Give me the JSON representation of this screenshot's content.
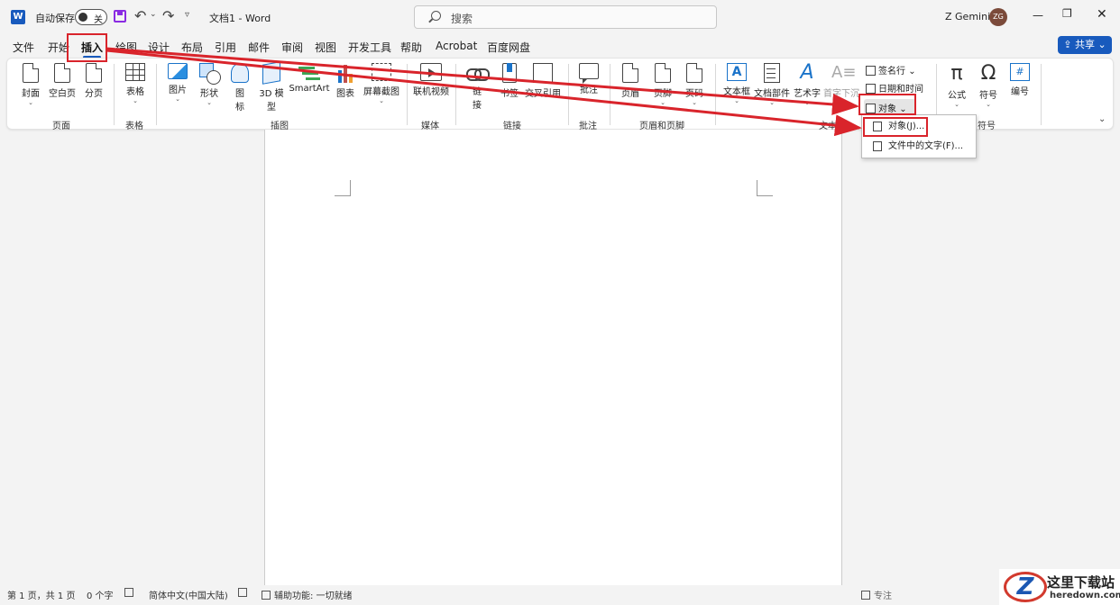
{
  "titlebar": {
    "app_letter": "W",
    "autosave_label": "自动保存",
    "autosave_state": "关",
    "doc_title": "文档1 - Word",
    "search_placeholder": "搜索",
    "user_name": "Z Gemini",
    "user_initials": "ZG"
  },
  "tabs": [
    "文件",
    "开始",
    "插入",
    "绘图",
    "设计",
    "布局",
    "引用",
    "邮件",
    "审阅",
    "视图",
    "开发工具",
    "帮助",
    "Acrobat",
    "百度网盘"
  ],
  "active_tab": "插入",
  "share_label": "共享",
  "ribbon": {
    "pages": {
      "label": "页面",
      "cover": "封面",
      "blank": "空白页",
      "break": "分页"
    },
    "tables": {
      "label": "表格",
      "table": "表格"
    },
    "illustrations": {
      "label": "插图",
      "pictures": "图片",
      "shapes": "形状",
      "icons_1": "图",
      "icons_2": "标",
      "model3d_1": "3D 模",
      "model3d_2": "型",
      "smartart": "SmartArt",
      "chart": "图表",
      "screenshot": "屏幕截图"
    },
    "media": {
      "label": "媒体",
      "video": "联机视频"
    },
    "links": {
      "label": "链接",
      "link_1": "链",
      "link_2": "接",
      "bookmark": "书签",
      "crossref": "交叉引用"
    },
    "comments": {
      "label": "批注",
      "comment": "批注"
    },
    "header_footer": {
      "label": "页眉和页脚",
      "header": "页眉",
      "footer": "页脚",
      "page_number": "页码"
    },
    "text": {
      "label": "文本",
      "textbox": "文本框",
      "quickparts": "文档部件",
      "wordart": "艺术字",
      "dropcap": "首字下沉",
      "signature": "签名行",
      "datetime": "日期和时间",
      "object": "对象"
    },
    "symbols": {
      "label": "符号",
      "equation": "公式",
      "symbol": "符号",
      "number": "编号"
    }
  },
  "object_menu": {
    "item1": "对象(J)...",
    "item2": "文件中的文字(F)..."
  },
  "status": {
    "page": "第 1 页，共 1 页",
    "words": "0 个字",
    "language": "简体中文(中国大陆)",
    "accessibility": "辅助功能: 一切就绪",
    "focus": "专注"
  },
  "watermark": {
    "logo_letter": "Z",
    "title": "这里下载站",
    "url": "heredown.com"
  },
  "colors": {
    "accent": "#185abd",
    "annotation": "#d9242b"
  }
}
